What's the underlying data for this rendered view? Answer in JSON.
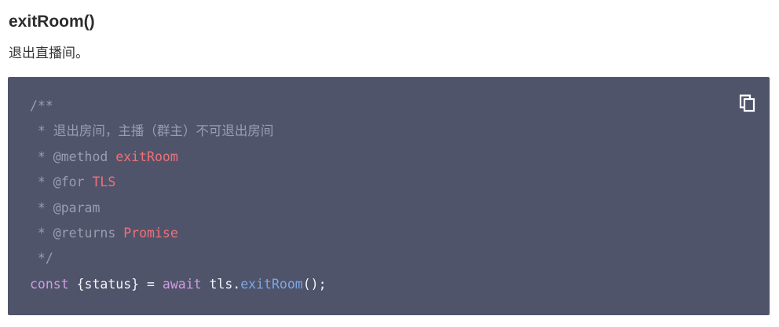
{
  "doc": {
    "heading": "exitRoom()",
    "description": "退出直播间。"
  },
  "code": {
    "copy_icon": "copy-icon",
    "lines": {
      "l1": {
        "comment": "/**"
      },
      "l2": {
        "prefix": " * ",
        "text": "退出房间，主播（群主）不可退出房间"
      },
      "l3": {
        "prefix": " * @method ",
        "value": "exitRoom"
      },
      "l4": {
        "prefix": " * @for ",
        "value": "TLS"
      },
      "l5": {
        "prefix": " * @param"
      },
      "l6": {
        "prefix": " * @returns ",
        "value": "Promise"
      },
      "l7": {
        "comment": " */"
      },
      "l8": {
        "kw1": "const",
        "t1": " {status} = ",
        "kw2": "await",
        "t2": " tls.",
        "fn": "exitRoom",
        "t3": "();"
      }
    }
  },
  "colors": {
    "code_background": "#50546b",
    "comment": "#9a9db0",
    "tag_value": "#f07178",
    "keyword": "#d29ce0",
    "function": "#7aa9ea",
    "text": "#f4f4f4"
  }
}
